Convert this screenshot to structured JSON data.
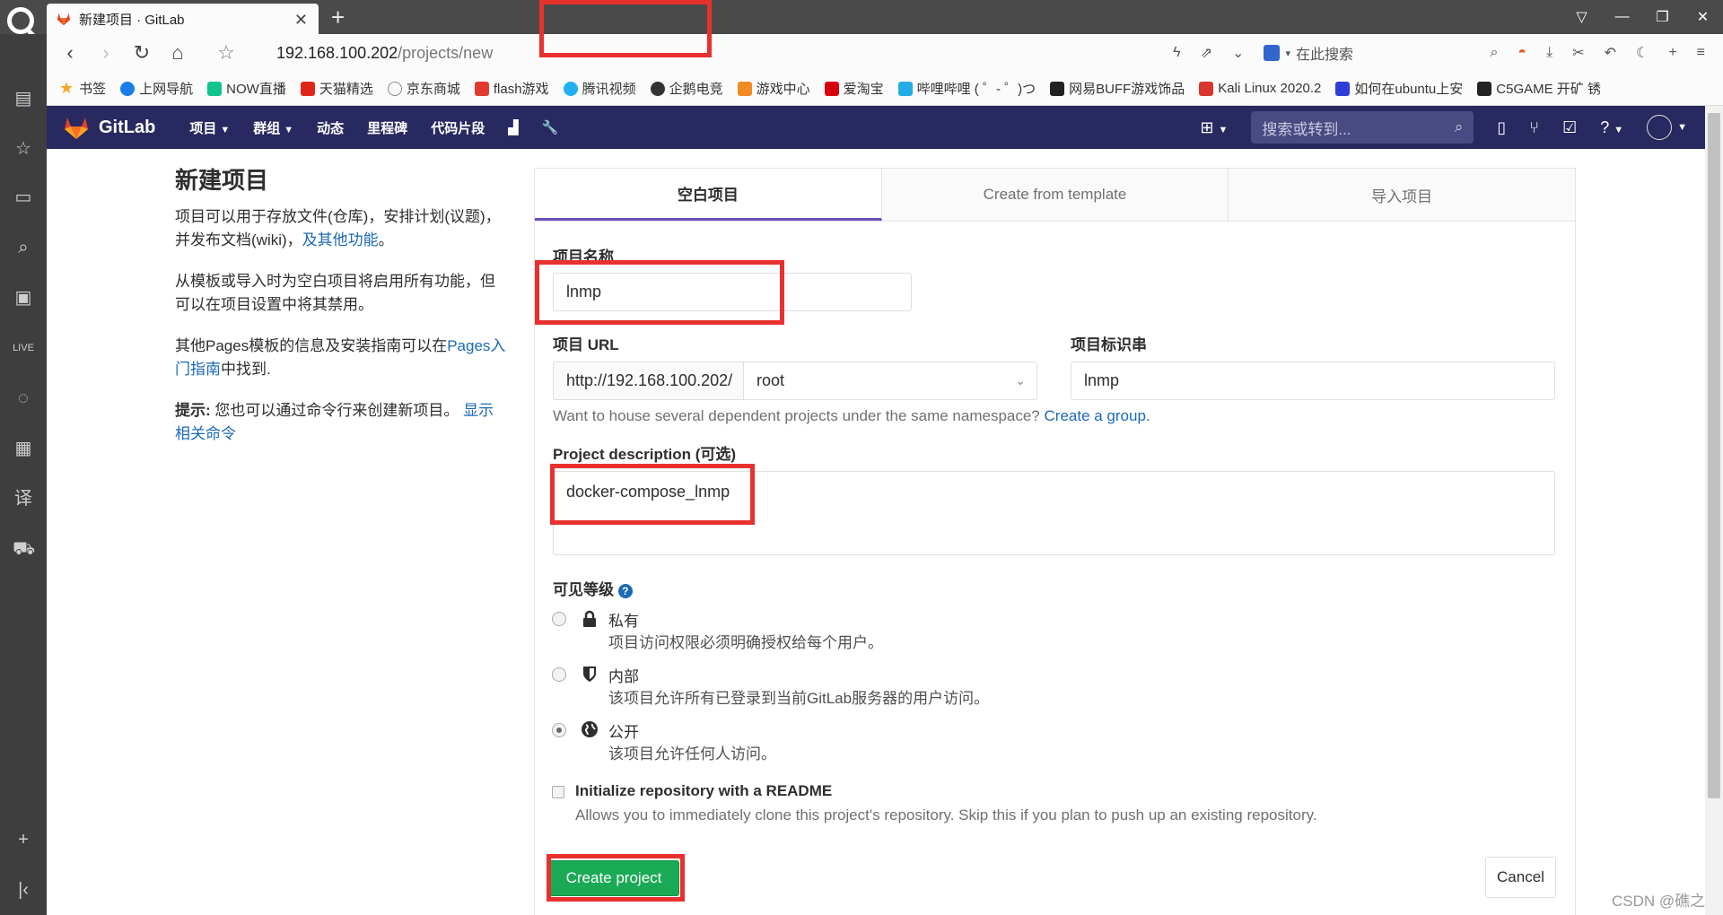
{
  "browser": {
    "tab_title": "新建项目 · GitLab",
    "tab_close": "✕",
    "new_tab": "+",
    "url_host": "192.168.100.202",
    "url_path": "/projects/new",
    "search_label": "在此搜索",
    "bookmarks": [
      "书签",
      "上网导航",
      "NOW直播",
      "天猫精选",
      "京东商城",
      "flash游戏",
      "腾讯视频",
      "企鹅电竞",
      "游戏中心",
      "爱淘宝",
      "哔哩哔哩 ( ゜- ゜)つ",
      "网易BUFF游戏饰品",
      "Kali Linux 2020.2",
      "如何在ubuntu上安",
      "C5GAME 开矿 锈"
    ]
  },
  "gitlab": {
    "logo_text": "GitLab",
    "nav": [
      "项目",
      "群组",
      "动态",
      "里程碑",
      "代码片段"
    ],
    "search_placeholder": "搜索或转到..."
  },
  "intro": {
    "title": "新建项目",
    "p1": "项目可以用于存放文件(仓库)，安排计划(议题)，并发布文档(wiki)，",
    "p1_link": "及其他功能",
    "p1_end": "。",
    "p2": "从模板或导入时为空白项目将启用所有功能，但可以在项目设置中将其禁用。",
    "p3_start": "其他Pages模板的信息及安装指南可以在",
    "p3_link": "Pages入门指南",
    "p3_end": "中找到.",
    "tip_label": "提示:",
    "tip_text": " 您也可以通过命令行来创建新项目。 ",
    "tip_link": "显示相关命令"
  },
  "tabs": [
    "空白项目",
    "Create from template",
    "导入项目"
  ],
  "form": {
    "name_label": "项目名称",
    "name_value": "lnmp",
    "url_label": "项目 URL",
    "url_prefix": "http://192.168.100.202/",
    "namespace": "root",
    "slug_label": "项目标识串",
    "slug_value": "lnmp",
    "group_help": "Want to house several dependent projects under the same namespace? ",
    "group_link": "Create a group.",
    "desc_label": "Project description (可选)",
    "desc_value": "docker-compose_lnmp",
    "visibility_label": "可见等级",
    "visibility": [
      {
        "title": "私有",
        "desc": "项目访问权限必须明确授权给每个用户。",
        "checked": false,
        "icon": "lock-icon"
      },
      {
        "title": "内部",
        "desc": "该项目允许所有已登录到当前GitLab服务器的用户访问。",
        "checked": false,
        "icon": "shield-icon"
      },
      {
        "title": "公开",
        "desc": "该项目允许任何人访问。",
        "checked": true,
        "icon": "globe-icon"
      }
    ],
    "readme_label": "Initialize repository with a README",
    "readme_desc": "Allows you to immediately clone this project's repository. Skip this if you plan to push up an existing repository.",
    "readme_checked": false,
    "create_button": "Create project",
    "cancel_button": "Cancel"
  },
  "watermark": "CSDN @礁之",
  "colors": {
    "gitlab_header": "#292961",
    "create_button": "#1aaa55",
    "link": "#1b69b6",
    "annotation_red": "#e8312f",
    "tab_active_underline": "#6b4fbb"
  }
}
